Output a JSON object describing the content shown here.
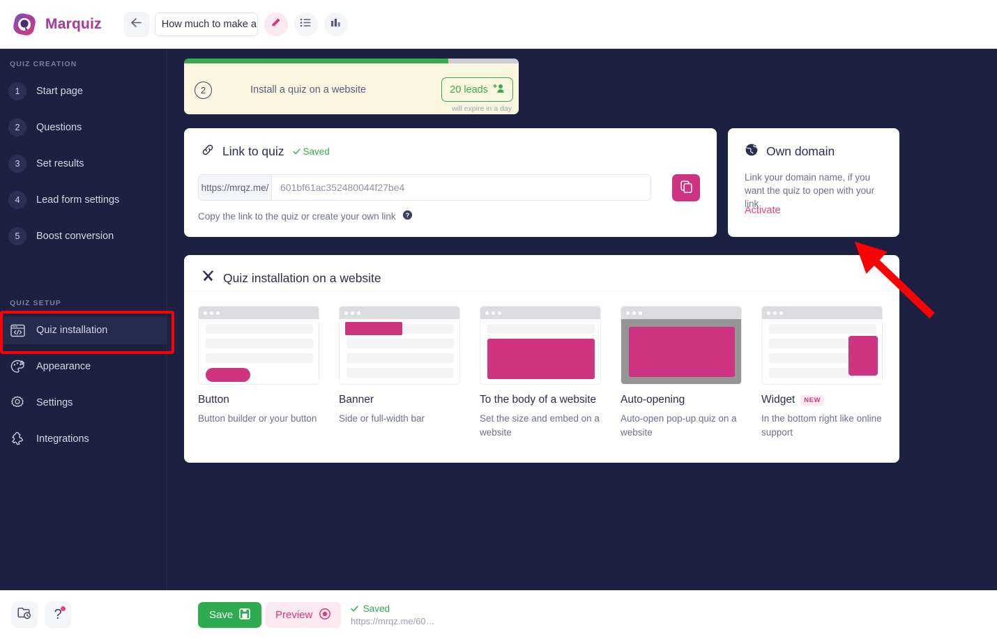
{
  "app": {
    "brand": "Marquiz",
    "quiz_title": "How much to make a",
    "header_icons": [
      "back-arrow-icon",
      "pencil-icon",
      "list-icon",
      "bar-chart-icon"
    ]
  },
  "sidebar": {
    "creation_title": "QUIZ CREATION",
    "steps": [
      {
        "num": "1",
        "label": "Start page"
      },
      {
        "num": "2",
        "label": "Questions"
      },
      {
        "num": "3",
        "label": "Set results"
      },
      {
        "num": "4",
        "label": "Lead form settings"
      },
      {
        "num": "5",
        "label": "Boost conversion"
      }
    ],
    "setup_title": "QUIZ SETUP",
    "setup_items": [
      {
        "label": "Quiz installation",
        "icon": "code-window-icon",
        "active": true
      },
      {
        "label": "Appearance",
        "icon": "palette-icon",
        "active": false
      },
      {
        "label": "Settings",
        "icon": "gear-icon",
        "active": false
      },
      {
        "label": "Integrations",
        "icon": "puzzle-icon",
        "active": false
      }
    ]
  },
  "leads_banner": {
    "step_number": "2",
    "text": "Install a quiz on a website",
    "pill_label": "20 leads",
    "pill_icon": "add-user-icon",
    "expire_note": "will expire in a day",
    "progress_percent": 79
  },
  "link_card": {
    "icon": "link-icon",
    "title": "Link to quiz",
    "saved_badge": "Saved",
    "prefix": "https://mrqz.me/",
    "slug_value": "601bf61ac352480044f27be4",
    "hint": "Copy the link to the quiz or create your own link",
    "help_icon": "question-circle-icon",
    "copy_icon": "copy-icon"
  },
  "domain_card": {
    "icon": "globe-icon",
    "title": "Own domain",
    "description": "Link your domain name, if you want the quiz to open with your link",
    "activate_label": "Activate"
  },
  "install_card": {
    "icon": "tools-icon",
    "title": "Quiz installation on a website",
    "tiles": [
      {
        "title": "Button",
        "desc": "Button builder or your button",
        "badge": "",
        "thumb": "button"
      },
      {
        "title": "Banner",
        "desc": "Side or full-width bar",
        "badge": "",
        "thumb": "banner"
      },
      {
        "title": "To the body of a website",
        "desc": "Set the size and embed on a website",
        "badge": "",
        "thumb": "body"
      },
      {
        "title": "Auto-opening",
        "desc": "Auto-open pop-up quiz on a website",
        "badge": "",
        "thumb": "popup"
      },
      {
        "title": "Widget",
        "desc": "In the bottom right like online support",
        "badge": "NEW",
        "thumb": "widget"
      }
    ]
  },
  "bottombar": {
    "history_icon": "folder-clock-icon",
    "help_icon": "question-mark-icon",
    "save_label": "Save",
    "save_icon": "floppy-disk-icon",
    "preview_label": "Preview",
    "preview_icon": "eye-icon",
    "saved_text": "Saved",
    "saved_url": "https://mrqz.me/60…"
  },
  "colors": {
    "accent_pink": "#cf3480",
    "sidebar_bg": "#1d2040",
    "green": "#2eab4f",
    "annotation_red": "#ff0000",
    "banner_bg": "#fbf6e0"
  }
}
